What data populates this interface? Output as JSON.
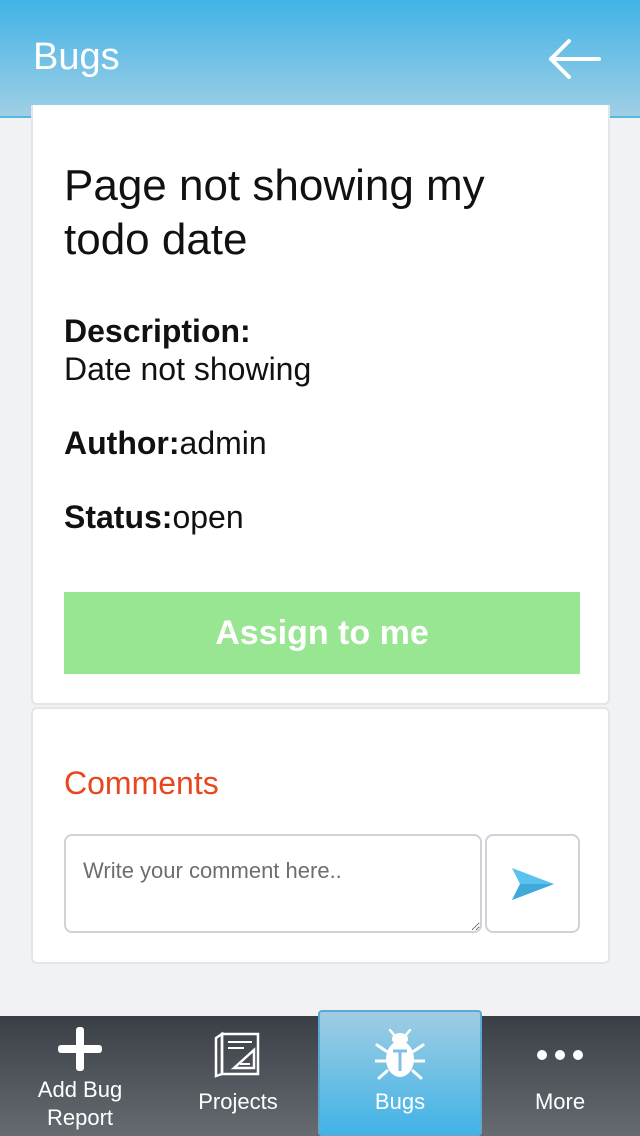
{
  "header": {
    "title": "Bugs",
    "back_icon": "arrow-left-icon"
  },
  "bug": {
    "title": "Page not showing my todo date",
    "description_label": "Description:",
    "description_value": "Date not showing",
    "author_label": "Author:",
    "author_value": "admin",
    "status_label": "Status:",
    "status_value": "open",
    "assign_button": "Assign to me",
    "assign_button_color": "#98e592"
  },
  "comments": {
    "title": "Comments",
    "title_color": "#e8461e",
    "input_placeholder": "Write your comment here..",
    "input_value": "",
    "send_icon": "send-paper-plane-icon"
  },
  "nav": {
    "items": [
      {
        "label": "Add Bug Report",
        "icon": "plus-icon",
        "active": false
      },
      {
        "label": "Projects",
        "icon": "blueprint-icon",
        "active": false
      },
      {
        "label": "Bugs",
        "icon": "bug-icon",
        "active": true
      },
      {
        "label": "More",
        "icon": "more-dots-icon",
        "active": false
      }
    ]
  },
  "colors": {
    "header_gradient_top": "#41b3e6",
    "header_gradient_bottom": "#9fcfe5",
    "nav_background": "#3a3f46"
  }
}
